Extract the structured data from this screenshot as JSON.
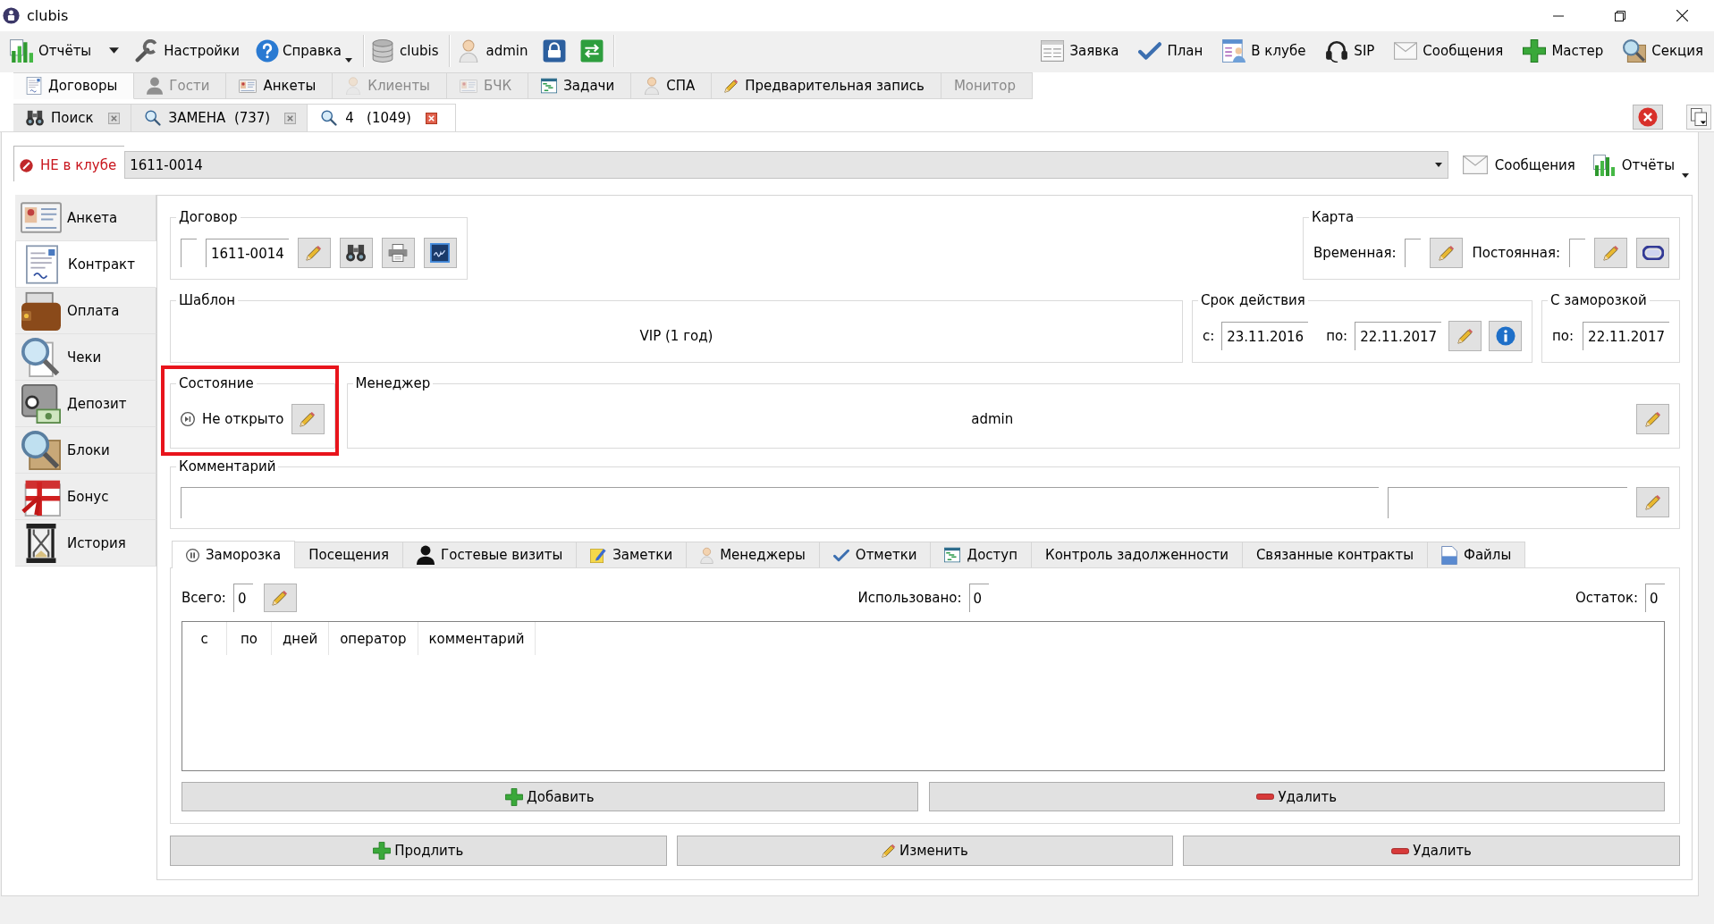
{
  "window": {
    "title": "clubis"
  },
  "toolbar": {
    "left_groups": [
      [
        {
          "kind": "split",
          "label": "Отчёты"
        },
        {
          "kind": "button",
          "label": "Настройки"
        },
        {
          "kind": "menu",
          "label": "Справка"
        }
      ],
      [
        {
          "kind": "button",
          "label": "clubis"
        }
      ],
      [
        {
          "kind": "button",
          "label": "admin"
        },
        {
          "kind": "icon"
        },
        {
          "kind": "icon"
        }
      ]
    ],
    "right": [
      {
        "label": "Заявка"
      },
      {
        "label": "План"
      },
      {
        "label": "В клубе"
      },
      {
        "label": "SIP"
      },
      {
        "label": "Сообщения"
      },
      {
        "label": "Мастер"
      },
      {
        "label": "Секция"
      }
    ]
  },
  "module_tabs": [
    {
      "label": "Договоры",
      "selected": true,
      "disabled": false
    },
    {
      "label": "Гости",
      "selected": false,
      "disabled": true
    },
    {
      "label": "Анкеты",
      "selected": false,
      "disabled": false
    },
    {
      "label": "Клиенты",
      "selected": false,
      "disabled": true
    },
    {
      "label": "БЧК",
      "selected": false,
      "disabled": true
    },
    {
      "label": "Задачи",
      "selected": false,
      "disabled": false
    },
    {
      "label": "СПА",
      "selected": false,
      "disabled": false
    },
    {
      "label": "Предварительная запись",
      "selected": false,
      "disabled": false
    },
    {
      "label": "Монитор",
      "selected": false,
      "disabled": true
    }
  ],
  "search_tabs": [
    {
      "label": "Поиск",
      "selected": false
    },
    {
      "label": "ЗАМЕНА  (737)",
      "selected": false
    },
    {
      "label": "4   (1049)",
      "selected": true
    }
  ],
  "client": {
    "in_club": false,
    "status": "НЕ в клубе",
    "contract": "1611-0014",
    "buttons": [
      {
        "kind": "button",
        "label": "Сообщения"
      },
      {
        "kind": "menu",
        "label": "Отчёты"
      }
    ]
  },
  "sidebar": {
    "items": [
      {
        "label": "Анкета",
        "selected": false
      },
      {
        "label": "Контракт",
        "selected": true
      },
      {
        "label": "Оплата",
        "selected": false
      },
      {
        "label": "Чеки",
        "selected": false
      },
      {
        "label": "Депозит",
        "selected": false
      },
      {
        "label": "Блоки",
        "selected": false
      },
      {
        "label": "Бонус",
        "selected": false
      },
      {
        "label": "История",
        "selected": false
      }
    ]
  },
  "contract": {
    "title": "Договор",
    "number": "1611-0014"
  },
  "card": {
    "title": "Карта",
    "temporary_label": "Временная:",
    "permanent_label": "Постоянная:"
  },
  "template": {
    "title": "Шаблон",
    "name": "VIP (1 год)"
  },
  "validity": {
    "title": "Срок действия",
    "from_label": "с:",
    "from": "23.11.2016",
    "to_label": "по:",
    "to": "22.11.2017"
  },
  "with_freeze": {
    "title": "С заморозкой",
    "to_label": "по:",
    "to": "22.11.2017"
  },
  "state": {
    "title": "Состояние",
    "value": "Не открыто",
    "highlighted": true
  },
  "manager": {
    "title": "Менеджер",
    "name": "admin"
  },
  "comment": {
    "title": "Комментарий"
  },
  "detail_tabs": [
    {
      "label": "Заморозка",
      "selected": true
    },
    {
      "label": "Посещения",
      "selected": false
    },
    {
      "label": "Гостевые визиты",
      "selected": false
    },
    {
      "label": "Заметки",
      "selected": false
    },
    {
      "label": "Менеджеры",
      "selected": false
    },
    {
      "label": "Отметки",
      "selected": false
    },
    {
      "label": "Доступ",
      "selected": false
    },
    {
      "label": "Контроль задолженности",
      "selected": false
    },
    {
      "label": "Связанные контракты",
      "selected": false
    },
    {
      "label": "Файлы",
      "selected": false
    }
  ],
  "freeze": {
    "total_label": "Всего:",
    "total": "0",
    "used_label": "Использовано:",
    "used": "0",
    "remaining_label": "Остаток:",
    "remaining": "0",
    "table": {
      "columns": [
        "с",
        "по",
        "дней",
        "оператор",
        "комментарий"
      ]
    },
    "buttons": [
      {
        "kind": "add",
        "label": "Добавить"
      },
      {
        "kind": "remove",
        "label": "Удалить"
      }
    ]
  },
  "actions": [
    {
      "kind": "add",
      "label": "Продлить"
    },
    {
      "kind": "edit",
      "label": "Изменить"
    },
    {
      "kind": "remove",
      "label": "Удалить"
    }
  ]
}
